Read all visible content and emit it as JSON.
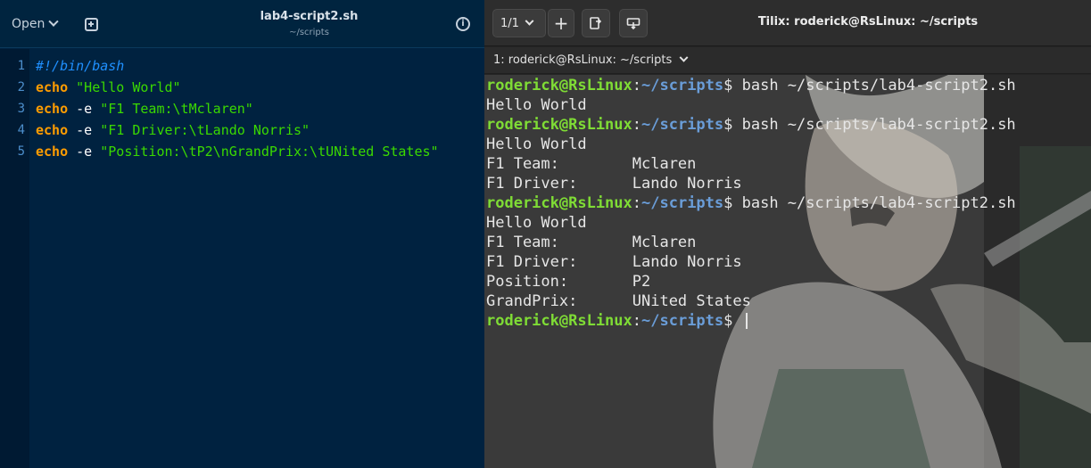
{
  "editor": {
    "open_label": "Open",
    "title": "lab4-script2.sh",
    "subtitle": "~/scripts",
    "info_glyph": "i",
    "lines": [
      {
        "num": "1",
        "comment": "#!/bin/bash",
        "kw": "",
        "arg": "",
        "str": ""
      },
      {
        "num": "2",
        "comment": "",
        "kw": "echo",
        "arg": " ",
        "str": "\"Hello World\""
      },
      {
        "num": "3",
        "comment": "",
        "kw": "echo",
        "arg": " -e ",
        "str": "\"F1 Team:\\tMclaren\""
      },
      {
        "num": "4",
        "comment": "",
        "kw": "echo",
        "arg": " -e ",
        "str": "\"F1 Driver:\\tLando Norris\""
      },
      {
        "num": "5",
        "comment": "",
        "kw": "echo",
        "arg": " -e ",
        "str": "\"Position:\\tP2\\nGrandPrix:\\tUNited States\""
      }
    ],
    "colors": {
      "background": "#002240",
      "keyword": "#ff9d00",
      "string": "#3ad900",
      "comment": "#1f90ff",
      "line_number": "#4c8ecb"
    }
  },
  "terminal": {
    "session_label": "1/1",
    "add_glyph": "+",
    "title": "Tilix: roderick@RsLinux: ~/scripts",
    "tab_label": "1: roderick@RsLinux: ~/scripts",
    "prompt_user": "roderick@RsLinux",
    "prompt_sep": ":",
    "prompt_path": "~/scripts",
    "prompt_end": "$ ",
    "lines": [
      {
        "prompt": true,
        "text": "bash ~/scripts/lab4-script2.sh"
      },
      {
        "prompt": false,
        "text": "Hello World"
      },
      {
        "prompt": true,
        "text": "bash ~/scripts/lab4-script2.sh"
      },
      {
        "prompt": false,
        "text": "Hello World"
      },
      {
        "prompt": false,
        "text": "F1 Team:        Mclaren"
      },
      {
        "prompt": false,
        "text": "F1 Driver:      Lando Norris"
      },
      {
        "prompt": true,
        "text": "bash ~/scripts/lab4-script2.sh"
      },
      {
        "prompt": false,
        "text": "Hello World"
      },
      {
        "prompt": false,
        "text": "F1 Team:        Mclaren"
      },
      {
        "prompt": false,
        "text": "F1 Driver:      Lando Norris"
      },
      {
        "prompt": false,
        "text": "Position:       P2"
      },
      {
        "prompt": false,
        "text": "GrandPrix:      UNited States"
      },
      {
        "prompt": true,
        "text": "",
        "cursor": true
      }
    ],
    "colors": {
      "prompt_user": "#7fdc35",
      "prompt_path": "#6a9dd8",
      "text": "#e6e6e6"
    }
  }
}
